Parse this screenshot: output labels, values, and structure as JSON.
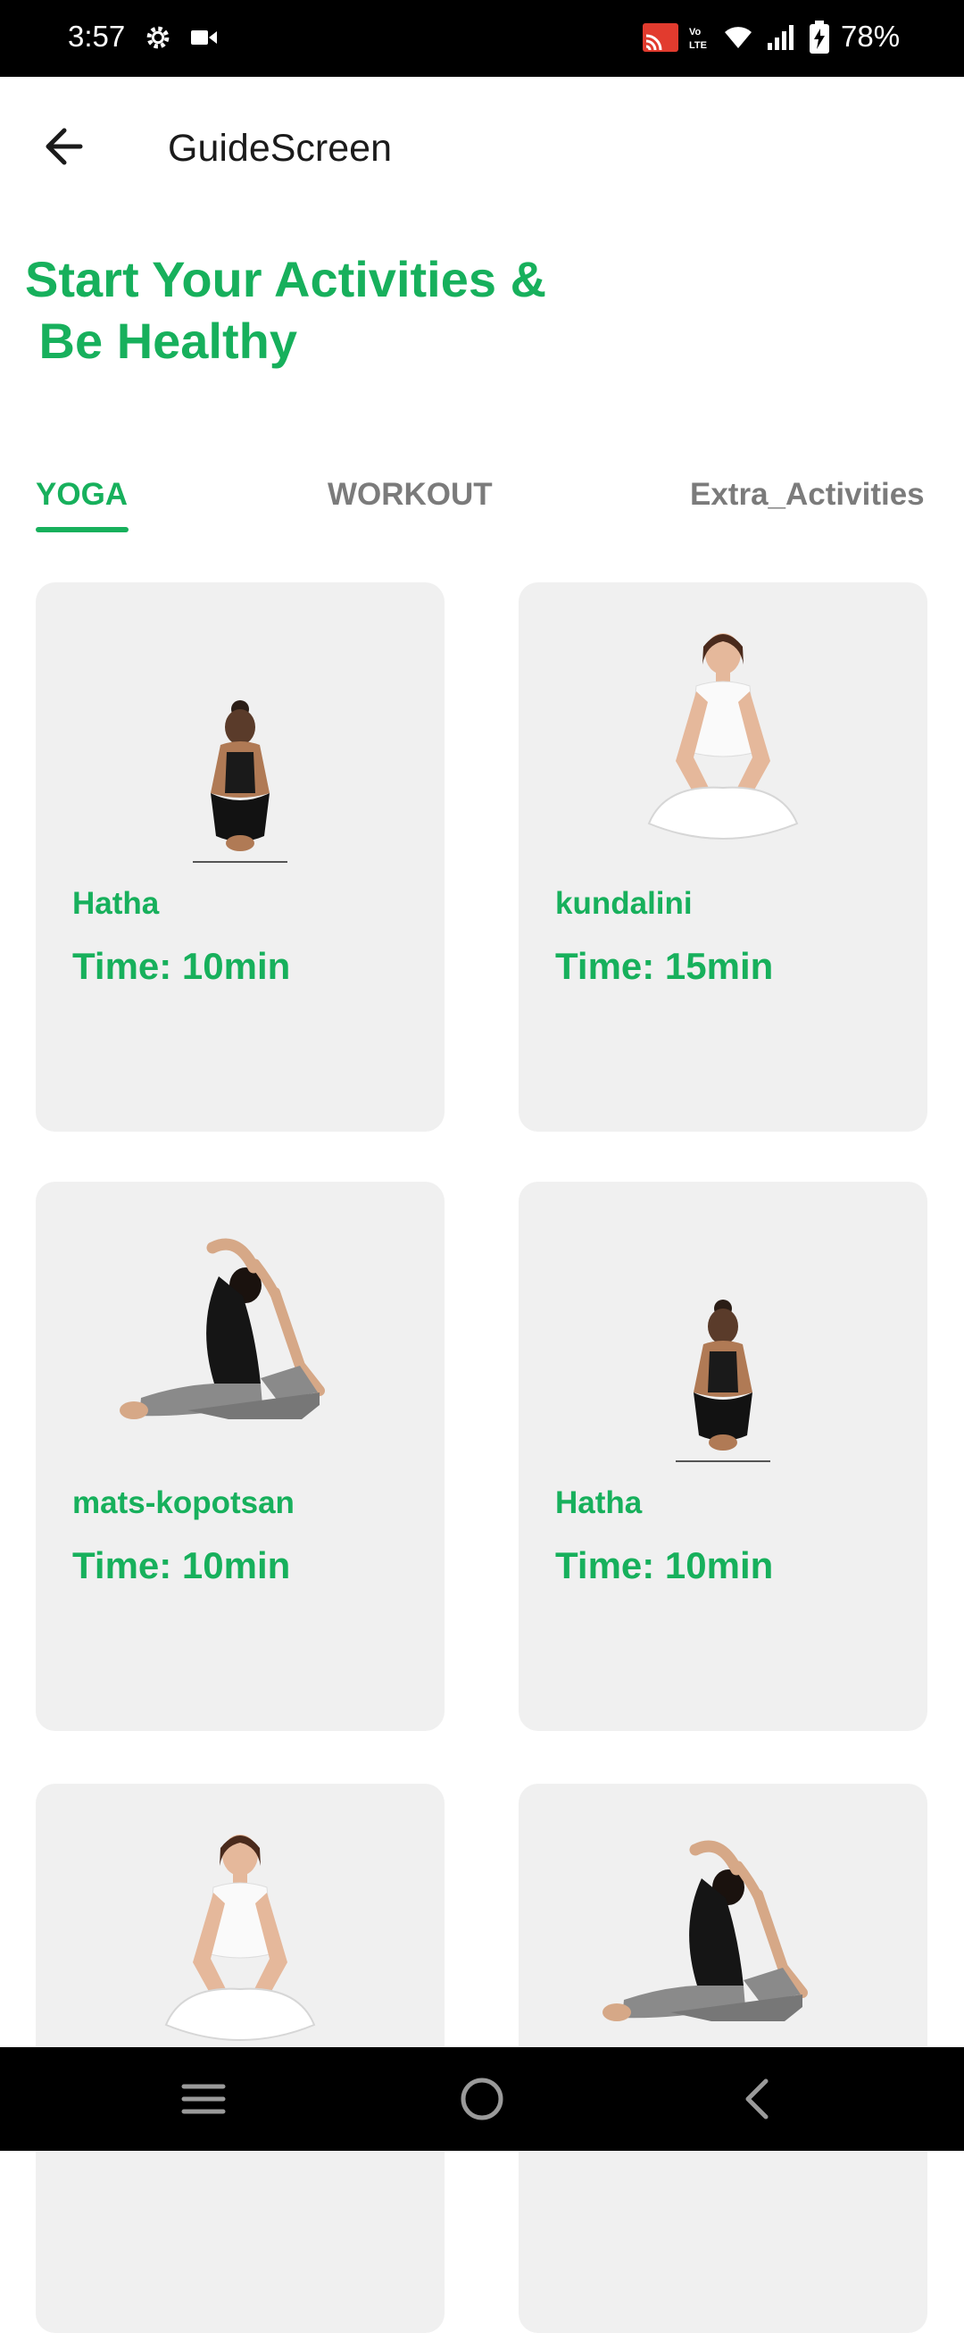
{
  "status_bar": {
    "time": "3:57",
    "battery_text": "78%",
    "icons": [
      "gear-icon",
      "video-icon",
      "cast-icon",
      "volte-icon",
      "wifi-icon",
      "signal-icon",
      "battery-icon"
    ]
  },
  "app_bar": {
    "title": "GuideScreen",
    "back_icon": "arrow-left-icon"
  },
  "headline": {
    "line1": "Start Your Activities &",
    "line2": " Be Healthy"
  },
  "tabs": [
    {
      "label": "YOGA",
      "active": true
    },
    {
      "label": "WORKOUT",
      "active": false
    },
    {
      "label": "Extra_Activities",
      "active": false
    }
  ],
  "cards": [
    {
      "name": "Hatha",
      "time": "Time: 10min",
      "pose": "kneeling-back-pose"
    },
    {
      "name": "kundalini",
      "time": "Time: 15min",
      "pose": "seated-meditation-pose"
    },
    {
      "name": "mats-kopotsan",
      "time": "Time: 10min",
      "pose": "pigeon-pose"
    },
    {
      "name": "Hatha",
      "time": "Time: 10min",
      "pose": "kneeling-back-pose"
    },
    {
      "name": "",
      "time": "",
      "pose": "seated-meditation-pose"
    },
    {
      "name": "",
      "time": "",
      "pose": "pigeon-pose"
    }
  ],
  "nav_bar": {
    "icons": [
      "menu-icon",
      "home-circle-icon",
      "back-chevron-icon"
    ]
  },
  "colors": {
    "accent": "#17b05c",
    "card_bg": "#f0f0f0",
    "tab_inactive": "#7b7b7b"
  }
}
